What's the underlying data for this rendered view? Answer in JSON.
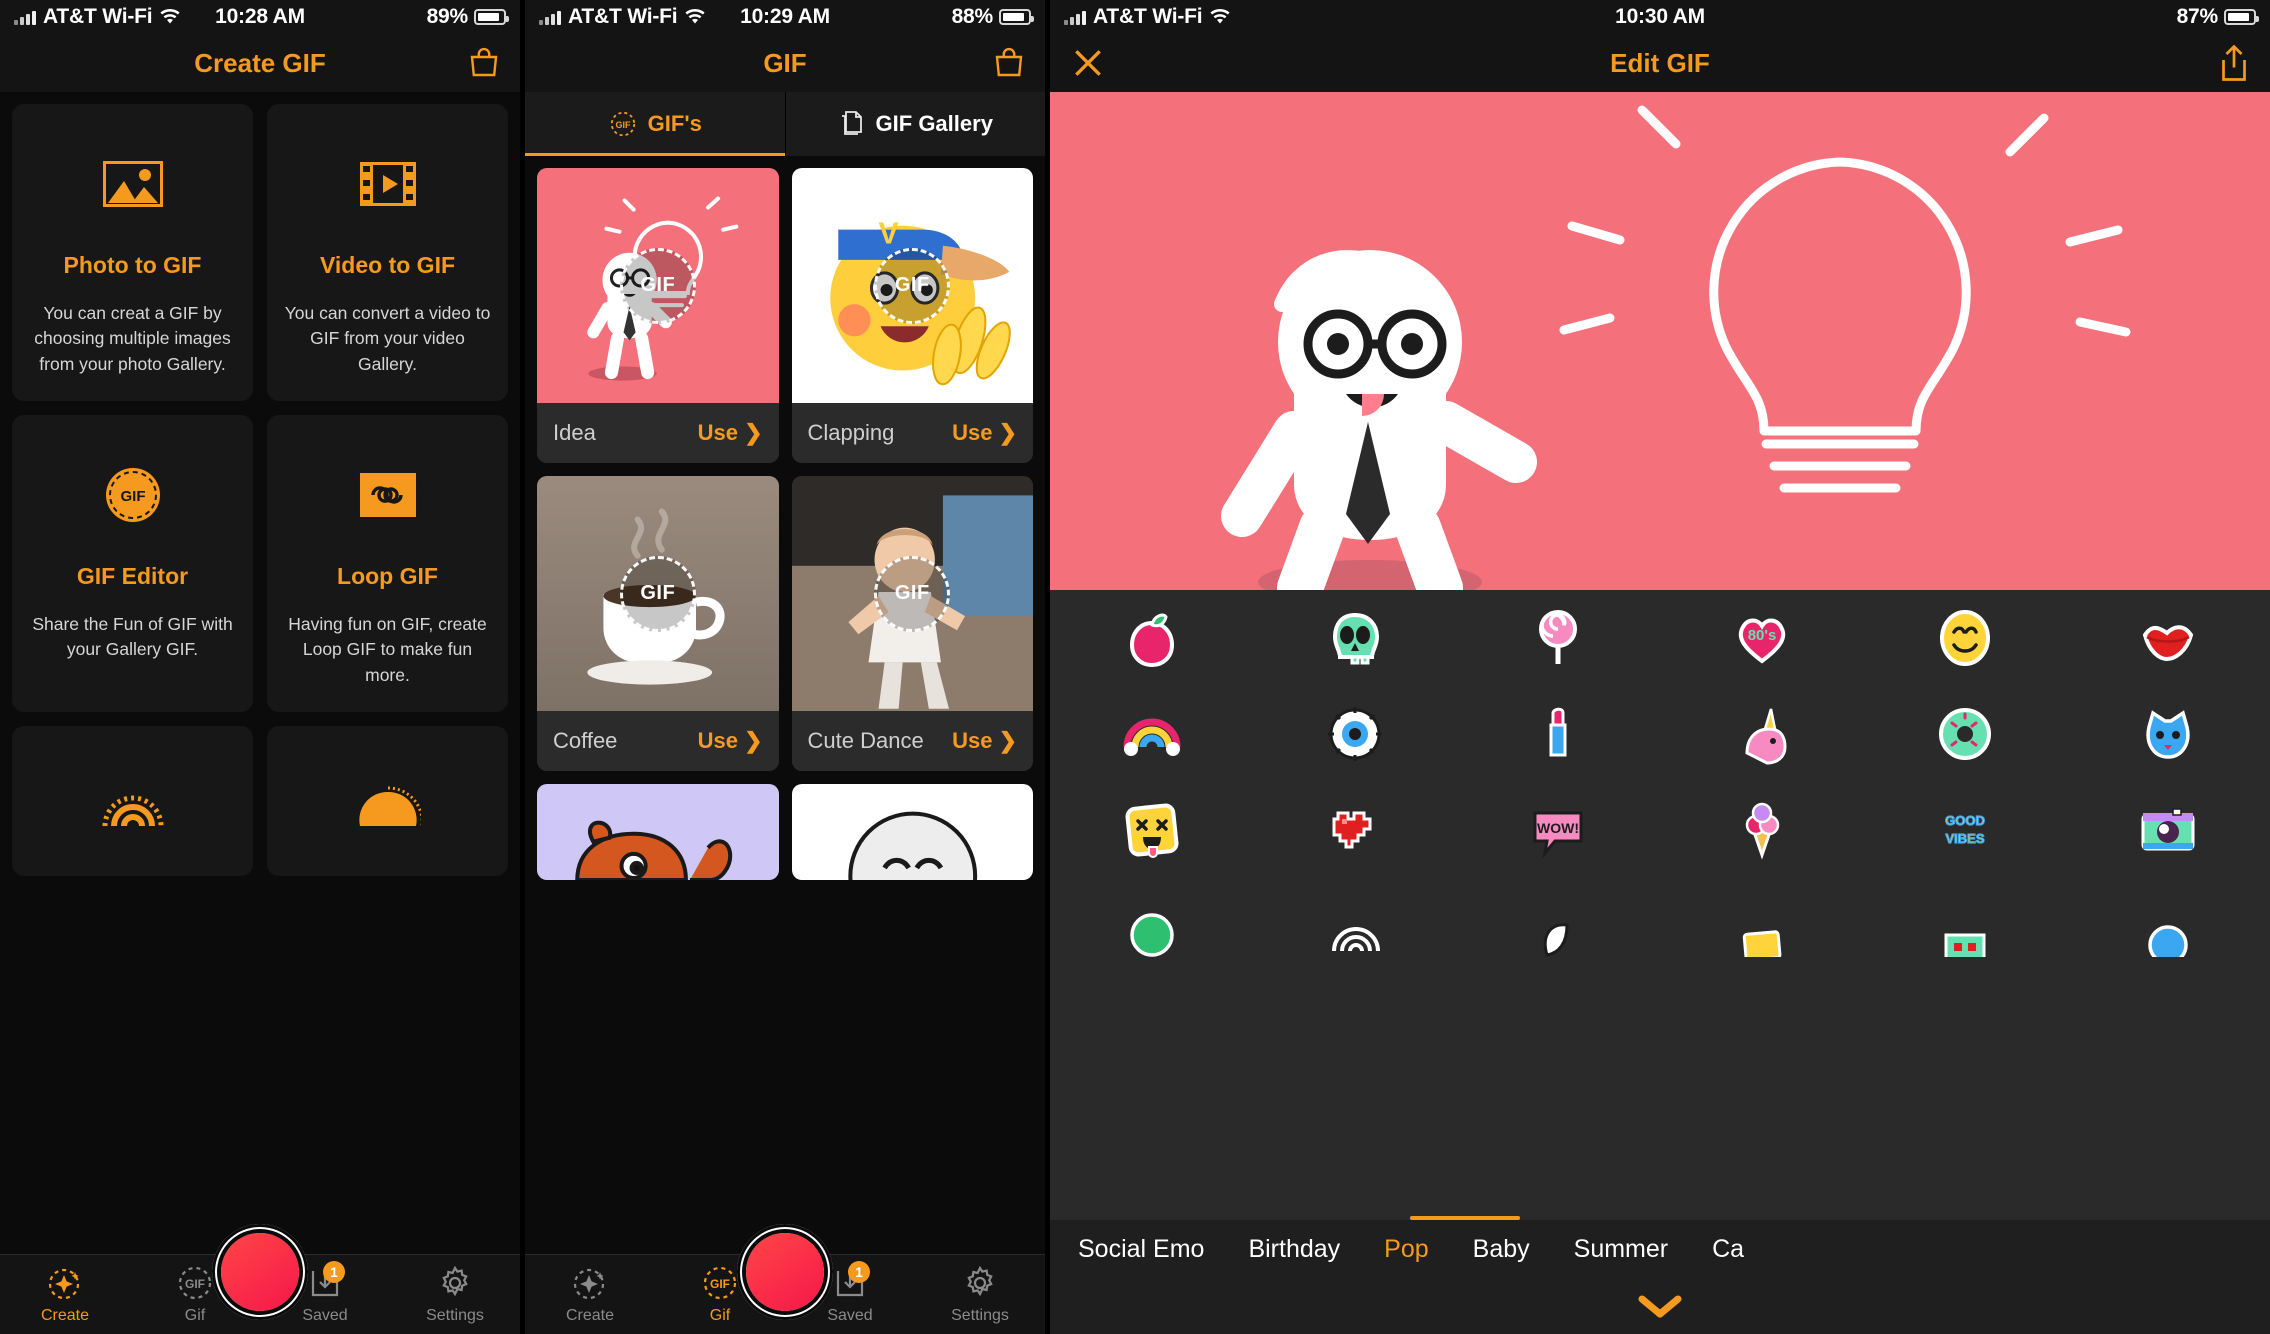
{
  "screens": [
    {
      "status": {
        "carrier": "AT&T Wi-Fi",
        "time": "10:28 AM",
        "battery": "89%"
      },
      "nav": {
        "title": "Create GIF",
        "right_icon": "shopping-bag-icon"
      },
      "cards": [
        {
          "icon": "image-icon",
          "title": "Photo to GIF",
          "desc": "You can creat a GIF by choosing multiple images from your photo Gallery."
        },
        {
          "icon": "video-film-icon",
          "title": "Video to GIF",
          "desc": "You can convert a video to GIF from your video Gallery."
        },
        {
          "icon": "gif-circle-icon",
          "title": "GIF Editor",
          "desc": "Share the Fun of GIF with your Gallery GIF."
        },
        {
          "icon": "infinity-icon",
          "title": "Loop GIF",
          "desc": "Having fun on GIF, create Loop GIF to make fun more."
        },
        {
          "icon": "rainbow-icon",
          "title": "",
          "desc": ""
        },
        {
          "icon": "sunrise-icon",
          "title": "",
          "desc": ""
        }
      ],
      "tabs": [
        {
          "label": "Create",
          "icon": "sparkle-dashed-icon",
          "active": true,
          "badge": ""
        },
        {
          "label": "Gif",
          "icon": "gif-dashed-icon",
          "active": false,
          "badge": ""
        },
        {
          "label": "Saved",
          "icon": "download-tray-icon",
          "active": false,
          "badge": "1"
        },
        {
          "label": "Settings",
          "icon": "gear-icon",
          "active": false,
          "badge": ""
        }
      ],
      "record_button": "record-button"
    },
    {
      "status": {
        "carrier": "AT&T Wi-Fi",
        "time": "10:29 AM",
        "battery": "88%"
      },
      "nav": {
        "title": "GIF",
        "right_icon": "shopping-bag-icon"
      },
      "segments": [
        {
          "label": "GIF's",
          "icon": "gif-dashed-icon",
          "active": true
        },
        {
          "label": "GIF Gallery",
          "icon": "stacked-pages-icon",
          "active": false
        }
      ],
      "gifs": [
        {
          "name": "Idea",
          "use": "Use ❯",
          "bg": "#F4717B",
          "art": "idea"
        },
        {
          "name": "Clapping",
          "use": "Use ❯",
          "bg": "#FFFFFF",
          "art": "clapping"
        },
        {
          "name": "Coffee",
          "use": "Use ❯",
          "bg": "#9E8F82",
          "art": "coffee"
        },
        {
          "name": "Cute Dance",
          "use": "Use ❯",
          "bg": "#6E6258",
          "art": "dance"
        },
        {
          "name": "",
          "use": "",
          "bg": "#CFC7F5",
          "art": "fish"
        },
        {
          "name": "",
          "use": "",
          "bg": "#FFFFFF",
          "art": "face"
        }
      ],
      "tabs": [
        {
          "label": "Create",
          "icon": "sparkle-dashed-icon",
          "active": false,
          "badge": ""
        },
        {
          "label": "Gif",
          "icon": "gif-dashed-icon",
          "active": true,
          "badge": ""
        },
        {
          "label": "Saved",
          "icon": "download-tray-icon",
          "active": false,
          "badge": "1"
        },
        {
          "label": "Settings",
          "icon": "gear-icon",
          "active": false,
          "badge": ""
        }
      ],
      "record_button": "record-button"
    },
    {
      "status": {
        "carrier": "AT&T Wi-Fi",
        "time": "10:30 AM",
        "battery": "87%"
      },
      "nav": {
        "title": "Edit GIF",
        "left_icon": "close-icon",
        "right_icon": "share-icon"
      },
      "canvas_bg": "#F4717B",
      "sticker_rows": [
        [
          "apple-sticker",
          "skull-sticker",
          "lollipop-sticker",
          "80s-heart-sticker",
          "smiley-sticker",
          "lips-sticker"
        ],
        [
          "rainbow-sticker",
          "eye-sticker",
          "lipstick-sticker",
          "unicorn-sticker",
          "donut-sticker",
          "cat-sticker"
        ],
        [
          "tongue-face-sticker",
          "pixel-heart-sticker",
          "wow-bubble-sticker",
          "icecream-sticker",
          "good-vibes-sticker",
          "camera-sticker"
        ],
        [
          "green-sticker",
          "swirl-sticker",
          "leaf-sticker",
          "yellow-note-sticker",
          "pixel-green-sticker",
          "blue-sticker"
        ]
      ],
      "categories": [
        {
          "label": "Social Emo",
          "active": false
        },
        {
          "label": "Birthday",
          "active": false
        },
        {
          "label": "Pop",
          "active": true
        },
        {
          "label": "Baby",
          "active": false
        },
        {
          "label": "Summer",
          "active": false
        },
        {
          "label": "Ca",
          "active": false
        }
      ],
      "collapse_icon": "chevron-down-icon"
    }
  ]
}
